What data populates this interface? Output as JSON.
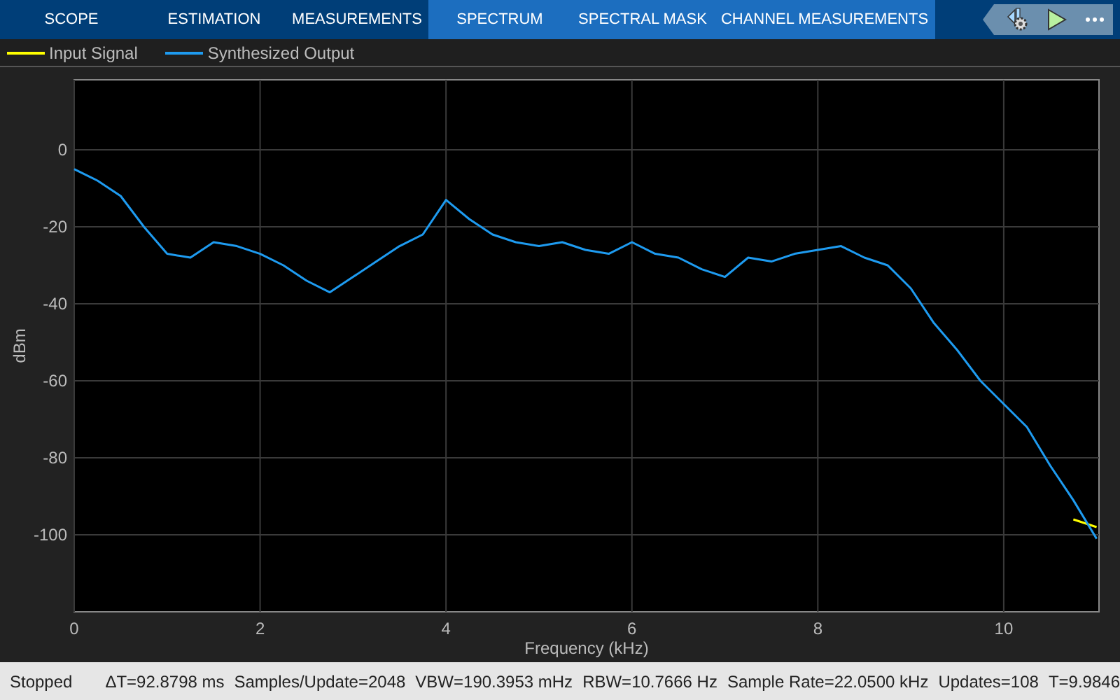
{
  "toolstrip": {
    "tabs": [
      {
        "label": "SCOPE",
        "contextual": false
      },
      {
        "label": "ESTIMATION",
        "contextual": false
      },
      {
        "label": "MEASUREMENTS",
        "contextual": false
      },
      {
        "label": "SPECTRUM",
        "contextual": true
      },
      {
        "label": "SPECTRAL MASK",
        "contextual": true
      },
      {
        "label": "CHANNEL MEASUREMENTS",
        "contextual": true
      }
    ]
  },
  "chart_data": {
    "type": "line",
    "xlabel": "Frequency (kHz)",
    "ylabel": "dBm",
    "grid": true,
    "x": [
      0,
      0.25,
      0.5,
      0.75,
      1,
      1.25,
      1.5,
      1.75,
      2,
      2.25,
      2.5,
      2.75,
      3,
      3.25,
      3.5,
      3.75,
      4,
      4.25,
      4.5,
      4.75,
      5,
      5.25,
      5.5,
      5.75,
      6,
      6.25,
      6.5,
      6.75,
      7,
      7.25,
      7.5,
      7.75,
      8,
      8.25,
      8.5,
      8.75,
      9,
      9.25,
      9.5,
      9.75,
      10,
      10.25,
      10.5,
      10.75,
      11
    ],
    "series": [
      {
        "name": "Input Signal",
        "color": "#ffff00",
        "values": [
          null,
          null,
          null,
          null,
          null,
          null,
          null,
          null,
          null,
          null,
          null,
          null,
          null,
          null,
          null,
          null,
          null,
          null,
          null,
          null,
          null,
          null,
          null,
          null,
          null,
          null,
          null,
          null,
          null,
          null,
          null,
          null,
          null,
          null,
          null,
          null,
          null,
          null,
          null,
          null,
          null,
          null,
          null,
          -96,
          -98
        ]
      },
      {
        "name": "Synthesized Output",
        "color": "#1e9bf0",
        "values": [
          -5,
          -8,
          -12,
          -20,
          -27,
          -28,
          -24,
          -25,
          -27,
          -30,
          -34,
          -37,
          -33,
          -29,
          -25,
          -22,
          -13,
          -18,
          -22,
          -24,
          -25,
          -24,
          -26,
          -27,
          -24,
          -27,
          -28,
          -31,
          -33,
          -28,
          -29,
          -27,
          -26,
          -25,
          -28,
          -30,
          -36,
          -45,
          -52,
          -60,
          -66,
          -72,
          -82,
          -91,
          -101
        ]
      }
    ],
    "xlim": [
      0,
      11.025
    ],
    "ylim": [
      -120,
      18.2
    ],
    "xticks": [
      0,
      2,
      4,
      6,
      8,
      10
    ],
    "yticks": [
      -100,
      -80,
      -60,
      -40,
      -20,
      0
    ]
  },
  "status_bar": {
    "state": "Stopped",
    "readings": [
      "ΔT=92.8798 ms",
      "Samples/Update=2048",
      "VBW=190.3953 mHz",
      "RBW=10.7666 Hz",
      "Sample Rate=22.0500 kHz",
      "Updates=108",
      "T=9.9846"
    ]
  }
}
